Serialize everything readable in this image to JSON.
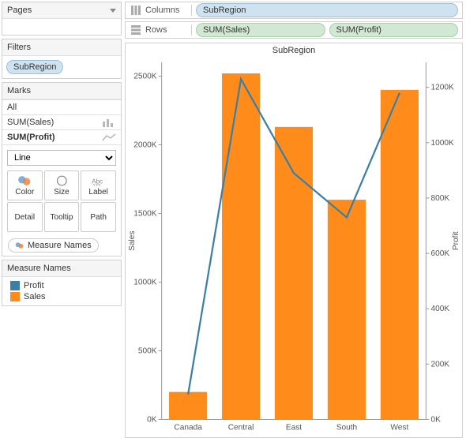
{
  "sidebar": {
    "pages_label": "Pages",
    "filters_label": "Filters",
    "filter_pill": "SubRegion",
    "marks_label": "Marks",
    "marks_all": "All",
    "marks_sales": "SUM(Sales)",
    "marks_profit": "SUM(Profit)",
    "mark_type": "Line",
    "btn_color": "Color",
    "btn_size": "Size",
    "btn_label": "Label",
    "btn_detail": "Detail",
    "btn_tooltip": "Tooltip",
    "btn_path": "Path",
    "color_shelf_pill": "Measure Names",
    "legend_header": "Measure Names",
    "legend": [
      {
        "name": "Profit",
        "color": "#3b7fa6"
      },
      {
        "name": "Sales",
        "color": "#ff8c1a"
      }
    ]
  },
  "shelves": {
    "columns_label": "Columns",
    "rows_label": "Rows",
    "columns_pill": "SubRegion",
    "rows_pill1": "SUM(Sales)",
    "rows_pill2": "SUM(Profit)"
  },
  "chart_data": {
    "type": "bar+line",
    "title": "SubRegion",
    "categories": [
      "Canada",
      "Central",
      "East",
      "South",
      "West"
    ],
    "series": [
      {
        "name": "Sales",
        "axis": "left",
        "chart": "bar",
        "values": [
          200000,
          2520000,
          2130000,
          1600000,
          2400000
        ]
      },
      {
        "name": "Profit",
        "axis": "right",
        "chart": "line",
        "values": [
          90000,
          1230000,
          890000,
          730000,
          1180000
        ]
      }
    ],
    "ylabel_left": "Sales",
    "ylabel_right": "Profit",
    "ylim_left": [
      0,
      2600000
    ],
    "ylim_right": [
      0,
      1290000
    ],
    "left_ticks": [
      "0K",
      "500K",
      "1000K",
      "1500K",
      "2000K",
      "2500K"
    ],
    "left_tick_vals": [
      0,
      500000,
      1000000,
      1500000,
      2000000,
      2500000
    ],
    "right_ticks": [
      "0K",
      "200K",
      "400K",
      "600K",
      "800K",
      "1000K",
      "1200K"
    ],
    "right_tick_vals": [
      0,
      200000,
      400000,
      600000,
      800000,
      1000000,
      1200000
    ],
    "xlabel": ""
  }
}
